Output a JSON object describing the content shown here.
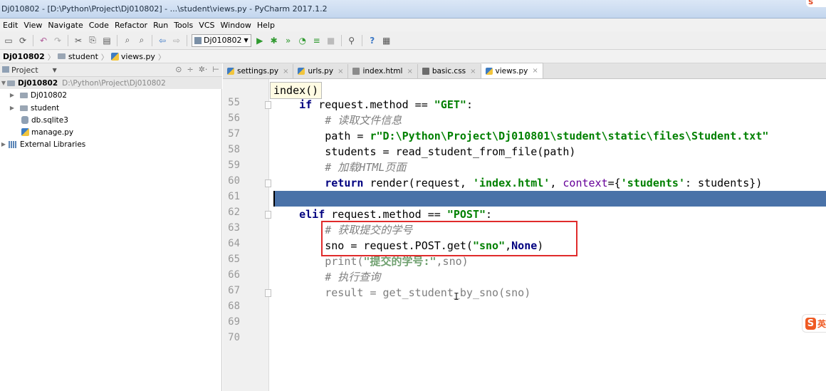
{
  "window": {
    "title": "Dj010802 - [D:\\Python\\Project\\Dj010802] - ...\\student\\views.py - PyCharm 2017.1.2"
  },
  "menu": [
    "Edit",
    "View",
    "Navigate",
    "Code",
    "Refactor",
    "Run",
    "Tools",
    "VCS",
    "Window",
    "Help"
  ],
  "toolbar": {
    "run_config": "Dj010802",
    "icons": [
      "save-icon",
      "sync-icon",
      "undo-icon",
      "redo-icon",
      "cut-icon",
      "copy-icon",
      "paste-icon",
      "find-icon",
      "replace-icon",
      "back-icon",
      "forward-icon",
      "run-icon",
      "debug-icon",
      "coverage-icon",
      "profile-icon",
      "concurrency-icon",
      "stop-icon",
      "vcs-icon",
      "help-icon",
      "sdk-icon"
    ]
  },
  "breadcrumbs": [
    "Dj010802",
    "student",
    "views.py"
  ],
  "project_panel": {
    "label": "Project",
    "tree": [
      {
        "name": "Dj010802",
        "path": "D:\\Python\\Project\\Dj010802",
        "type": "root"
      },
      {
        "name": "Dj010802",
        "type": "folder"
      },
      {
        "name": "student",
        "type": "folder"
      },
      {
        "name": "db.sqlite3",
        "type": "db"
      },
      {
        "name": "manage.py",
        "type": "py"
      },
      {
        "name": "External Libraries",
        "type": "lib"
      }
    ]
  },
  "tabs": [
    {
      "label": "settings.py",
      "type": "py",
      "active": false
    },
    {
      "label": "urls.py",
      "type": "py",
      "active": false
    },
    {
      "label": "index.html",
      "type": "html",
      "active": false
    },
    {
      "label": "basic.css",
      "type": "css",
      "active": false
    },
    {
      "label": "views.py",
      "type": "py",
      "active": true
    }
  ],
  "tooltip": "index()",
  "line_numbers": [
    "55",
    "56",
    "57",
    "58",
    "59",
    "60",
    "61",
    "62",
    "63",
    "64",
    "65",
    "66",
    "67",
    "68",
    "69",
    "70"
  ],
  "code": {
    "l55_kw": "if",
    "l55_a": " request.method == ",
    "l55_str": "\"GET\"",
    "l55_b": ":",
    "l56": "# 读取文件信息",
    "l57_a": "path = ",
    "l57_str": "r\"D:\\Python\\Project\\Dj010801\\student\\static\\files\\Student.txt\"",
    "l58": "students = read_student_from_file(path)",
    "l59": "# 加载HTML页面",
    "l60_kw": "return",
    "l60_a": " render(request, ",
    "l60_str1": "'index.html'",
    "l60_b": ", ",
    "l60_prm": "context",
    "l60_c": "={",
    "l60_str2": "'students'",
    "l60_d": ": students})",
    "l62_kw": "elif",
    "l62_a": " request.method == ",
    "l62_str": "\"POST\"",
    "l62_b": ":",
    "l63": "# 获取提交的学号",
    "l64_a": "sno = request.POST.get(",
    "l64_str": "\"sno\"",
    "l64_b": ",",
    "l64_kw": "None",
    "l64_c": ")",
    "l65_a": "print(",
    "l65_str": "\"提交的学号:\"",
    "l65_b": ",sno)",
    "l66": "# 执行查询",
    "l67": "result = get_student_by_sno(sno)"
  },
  "ime": {
    "char": "S",
    "label": "英"
  },
  "colors": {
    "keyword": "#000080",
    "string": "#008000",
    "comment": "#808080",
    "current_line": "#4a72a8",
    "highlight_box": "#e02b2b"
  }
}
